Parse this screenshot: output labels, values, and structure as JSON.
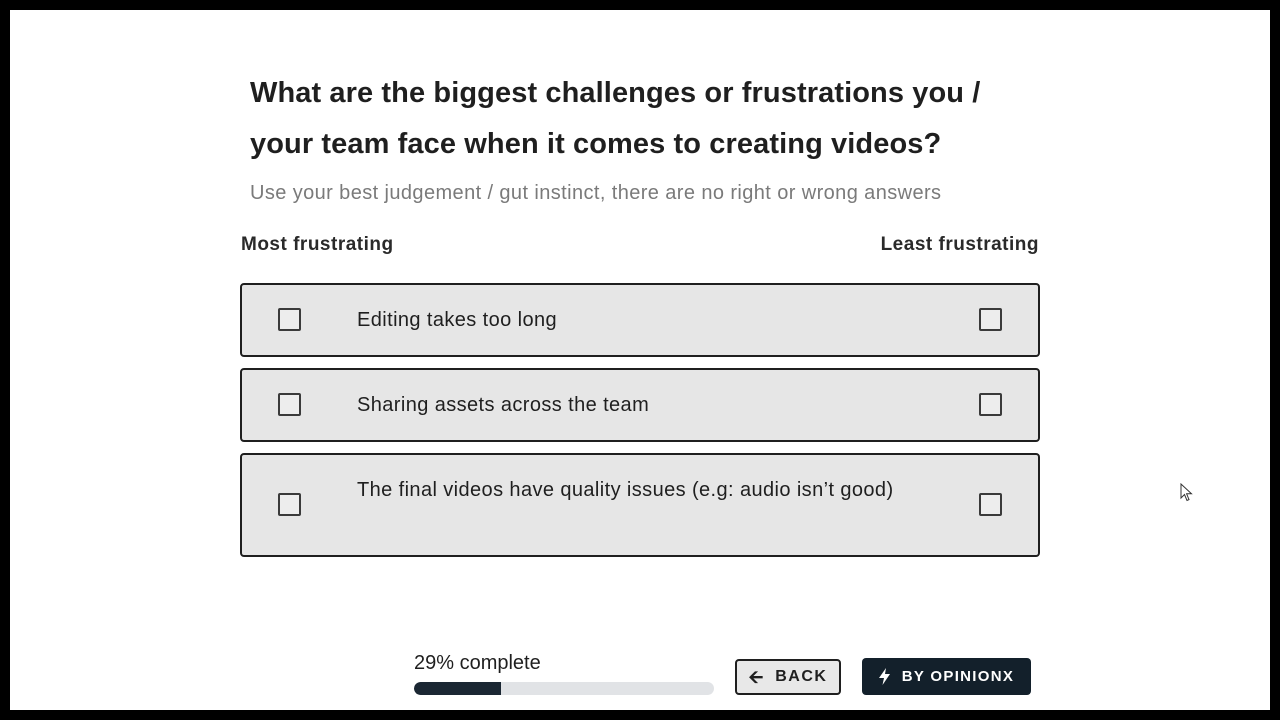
{
  "question": {
    "title": "What are the biggest challenges or frustrations you / your team face when it comes to creating videos?",
    "subtitle": "Use your best judgement / gut instinct, there are no right or wrong answers"
  },
  "scale": {
    "left_label": "Most frustrating",
    "right_label": "Least frustrating"
  },
  "options": [
    {
      "label": "Editing takes too long",
      "most_checked": false,
      "least_checked": false
    },
    {
      "label": "Sharing assets across the team",
      "most_checked": false,
      "least_checked": false
    },
    {
      "label": "The final videos have quality issues (e.g: audio isn’t good)",
      "most_checked": false,
      "least_checked": false
    }
  ],
  "progress": {
    "label": "29% complete",
    "percent": 29
  },
  "buttons": {
    "back_label": "BACK",
    "back_icon": "arrow-left-icon",
    "brand_label": "BY OPINIONX",
    "brand_icon": "lightning-bolt-icon"
  },
  "colors": {
    "row_background": "#e6e6e6",
    "progress_fill": "#1b2733",
    "brand_button": "#13202b"
  }
}
